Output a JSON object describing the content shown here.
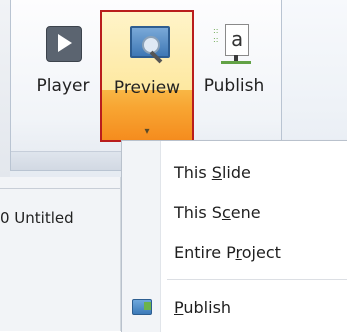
{
  "ribbon": {
    "buttons": [
      {
        "label": "Player",
        "icon": "player-icon"
      },
      {
        "label": "Preview",
        "icon": "preview-icon",
        "dropdown_arrow": "▾"
      },
      {
        "label": "Publish",
        "icon": "publish-icon"
      }
    ]
  },
  "document_tab": {
    "label": "0 Untitled"
  },
  "dropdown_menu": {
    "items": [
      {
        "pre": "This ",
        "key": "S",
        "post": "lide"
      },
      {
        "pre": "This S",
        "key": "c",
        "post": "ene"
      },
      {
        "pre": "Entire P",
        "key": "r",
        "post": "oject"
      },
      {
        "pre": "",
        "key": "P",
        "post": "ublish",
        "icon": "publish-menu-icon"
      }
    ]
  },
  "colors": {
    "preview_highlight_border": "#b91d1d",
    "preview_highlight_fill": "#f8a532"
  }
}
